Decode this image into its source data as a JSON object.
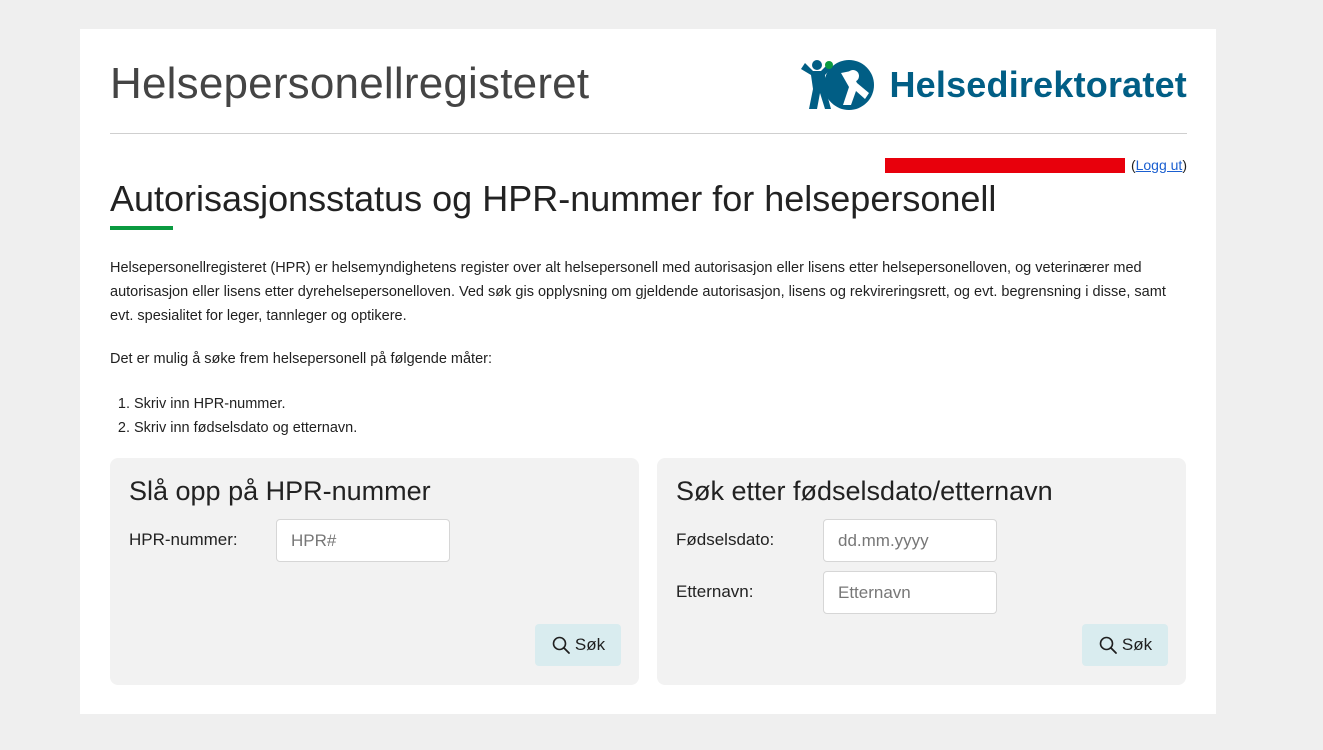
{
  "header": {
    "site_title": "Helsepersonellregisteret",
    "logo_text": "Helsedirektoratet",
    "logo_icon": "helsedirektoratet-figures-logo"
  },
  "user": {
    "logout_prefix": "(",
    "logout_label": "Logg ut",
    "logout_suffix": ")"
  },
  "main": {
    "heading": "Autorisasjonsstatus og HPR-nummer for helsepersonell",
    "intro": "Helsepersonellregisteret (HPR) er helsemyndighetens register over alt helsepersonell med autorisasjon eller lisens etter helsepersonelloven, og veterinærer med autorisasjon eller lisens etter dyrehelsepersonelloven. Ved søk gis opplysning om gjeldende autorisasjon, lisens og rekvireringsrett, og evt. begrensning i disse, samt evt. spesialitet for leger, tannleger og optikere.",
    "methods_intro": "Det er mulig å søke frem helsepersonell på følgende måter:",
    "methods": [
      "Skriv inn HPR-nummer.",
      "Skriv inn fødselsdato og etternavn."
    ]
  },
  "hpr_panel": {
    "title": "Slå opp på HPR-nummer",
    "hpr_label": "HPR-nummer:",
    "hpr_placeholder": "HPR#",
    "hpr_value": "",
    "search_label": "Søk"
  },
  "dob_panel": {
    "title": "Søk etter fødselsdato/etternavn",
    "dob_label": "Fødselsdato:",
    "dob_placeholder": "dd.mm.yyyy",
    "dob_value": "",
    "lastname_label": "Etternavn:",
    "lastname_placeholder": "Etternavn",
    "lastname_value": "",
    "search_label": "Søk"
  },
  "colors": {
    "accent_green": "#0a9a40",
    "logo_blue": "#015e85",
    "redaction_red": "#e8000c",
    "button_bg": "#d9ecef",
    "link_blue": "#1a5fd0"
  }
}
